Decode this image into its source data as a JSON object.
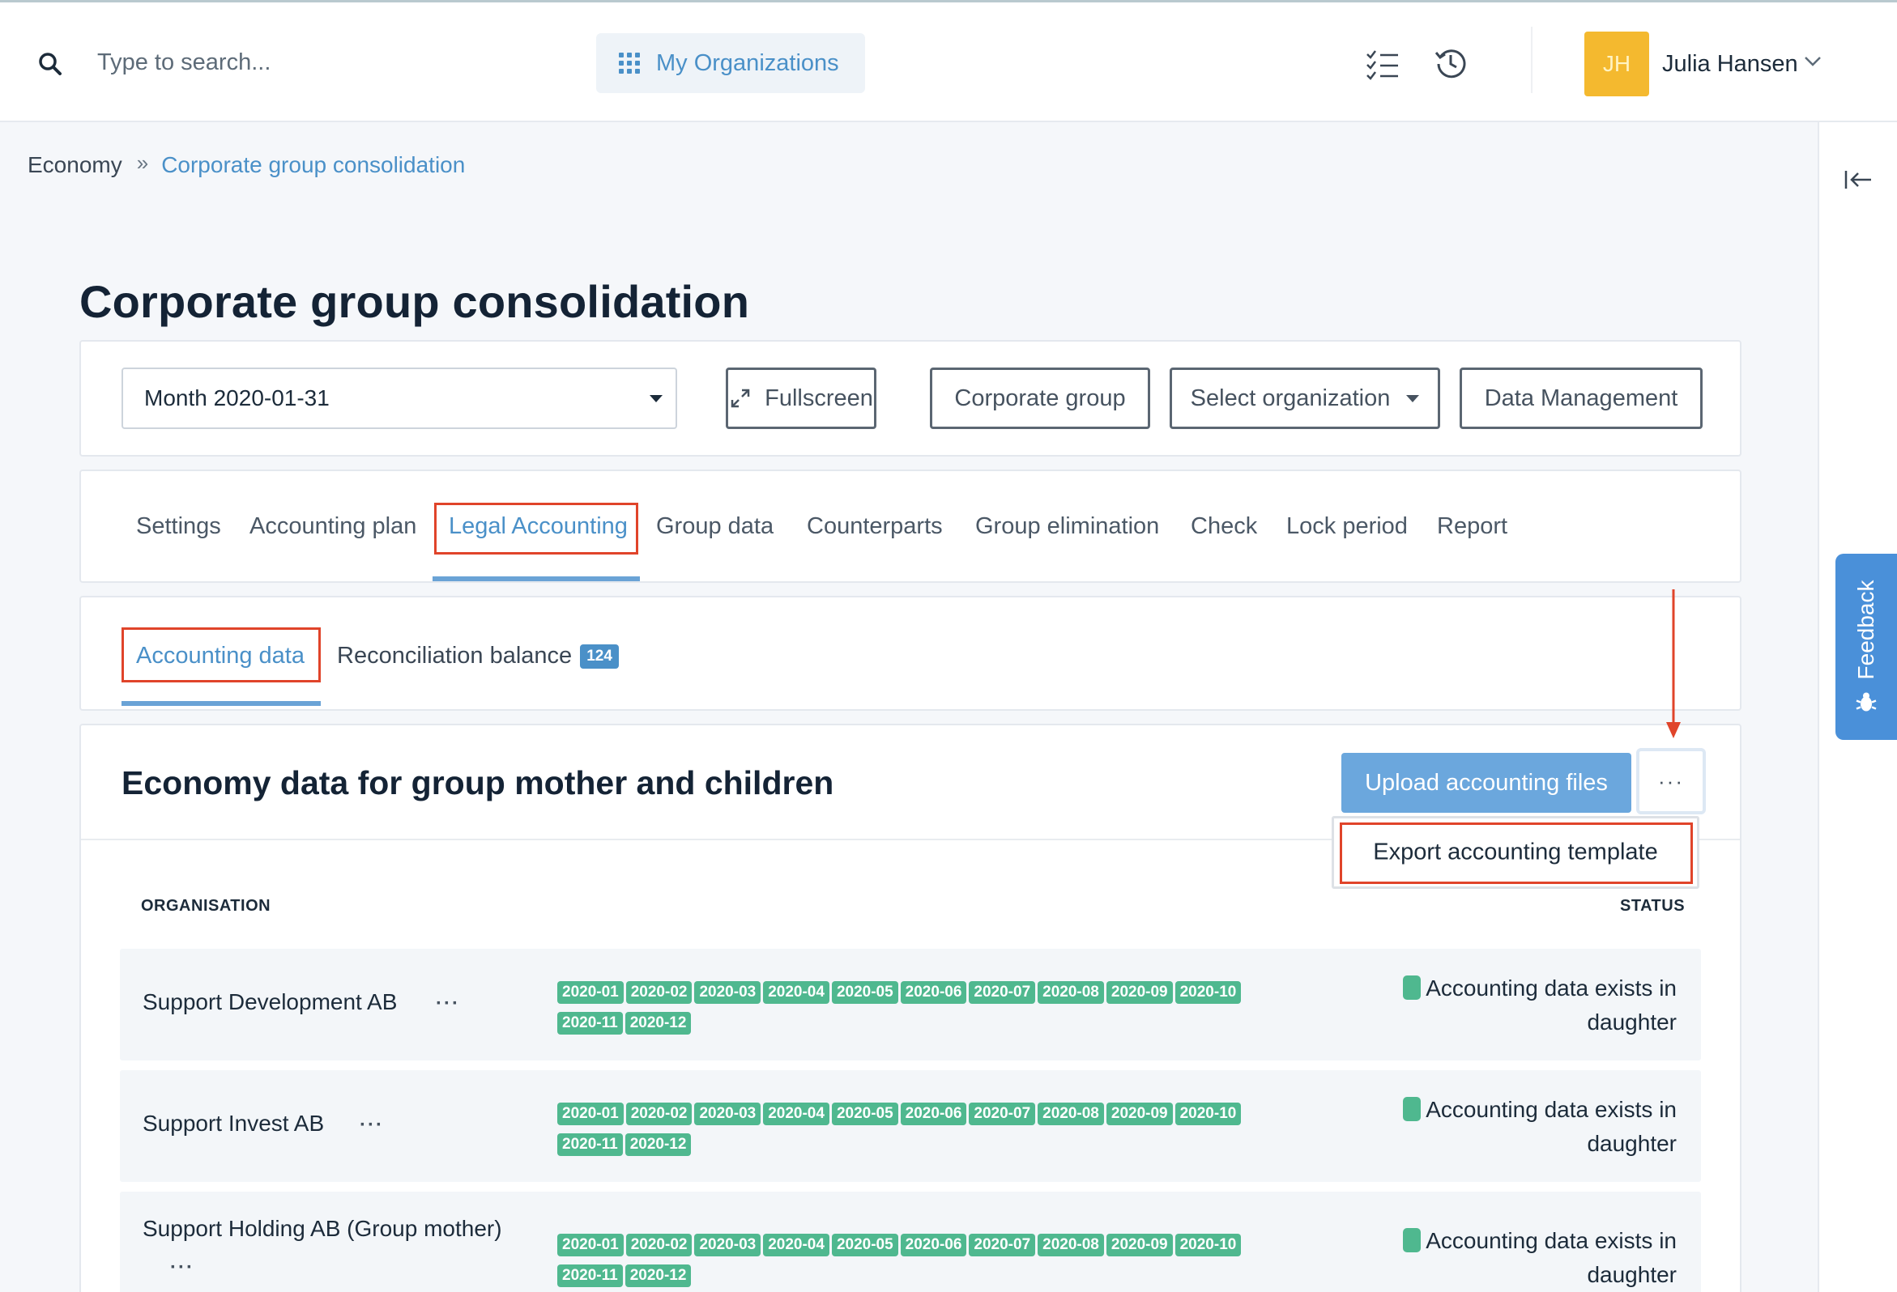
{
  "topbar": {
    "search_placeholder": "Type to search...",
    "org_button": "My Organizations",
    "avatar_initials": "JH",
    "user_name": "Julia Hansen"
  },
  "breadcrumb": {
    "root": "Economy",
    "separator": "»",
    "current": "Corporate group consolidation"
  },
  "page": {
    "title": "Corporate group consolidation"
  },
  "toolbar": {
    "month_select": "Month 2020-01-31",
    "fullscreen": "Fullscreen",
    "corporate_group": "Corporate group",
    "select_organization": "Select organization",
    "data_management": "Data Management"
  },
  "tabs": [
    {
      "label": "Settings"
    },
    {
      "label": "Accounting plan"
    },
    {
      "label": "Legal Accounting"
    },
    {
      "label": "Group data"
    },
    {
      "label": "Counterparts"
    },
    {
      "label": "Group elimination"
    },
    {
      "label": "Check"
    },
    {
      "label": "Lock period"
    },
    {
      "label": "Report"
    }
  ],
  "subtabs": {
    "accounting_data": "Accounting data",
    "reconciliation_balance": "Reconciliation balance",
    "reconciliation_count": "124"
  },
  "section": {
    "title": "Economy data for group mother and children",
    "upload_button": "Upload accounting files",
    "more_button": "···",
    "dropdown_item": "Export accounting template",
    "col_organisation": "ORGANISATION",
    "col_status": "STATUS"
  },
  "rows": [
    {
      "name": "Support Development AB",
      "more": "···",
      "periods": [
        "2020-01",
        "2020-02",
        "2020-03",
        "2020-04",
        "2020-05",
        "2020-06",
        "2020-07",
        "2020-08",
        "2020-09",
        "2020-10",
        "2020-11",
        "2020-12"
      ],
      "status_line1": "Accounting data exists in",
      "status_line2": "daughter"
    },
    {
      "name": "Support Invest AB",
      "more": "···",
      "periods": [
        "2020-01",
        "2020-02",
        "2020-03",
        "2020-04",
        "2020-05",
        "2020-06",
        "2020-07",
        "2020-08",
        "2020-09",
        "2020-10",
        "2020-11",
        "2020-12"
      ],
      "status_line1": "Accounting data exists in",
      "status_line2": "daughter"
    },
    {
      "name": "Support Holding AB (Group mother)",
      "more": "···",
      "periods": [
        "2020-01",
        "2020-02",
        "2020-03",
        "2020-04",
        "2020-05",
        "2020-06",
        "2020-07",
        "2020-08",
        "2020-09",
        "2020-10",
        "2020-11",
        "2020-12"
      ],
      "status_line1": "Accounting data exists in",
      "status_line2": "daughter"
    }
  ],
  "feedback": {
    "label": "Feedback"
  },
  "colors": {
    "accent": "#4a90c8",
    "badge_green": "#4fb88f",
    "annotation_red": "#e0442a",
    "avatar_yellow": "#f4b92f"
  }
}
